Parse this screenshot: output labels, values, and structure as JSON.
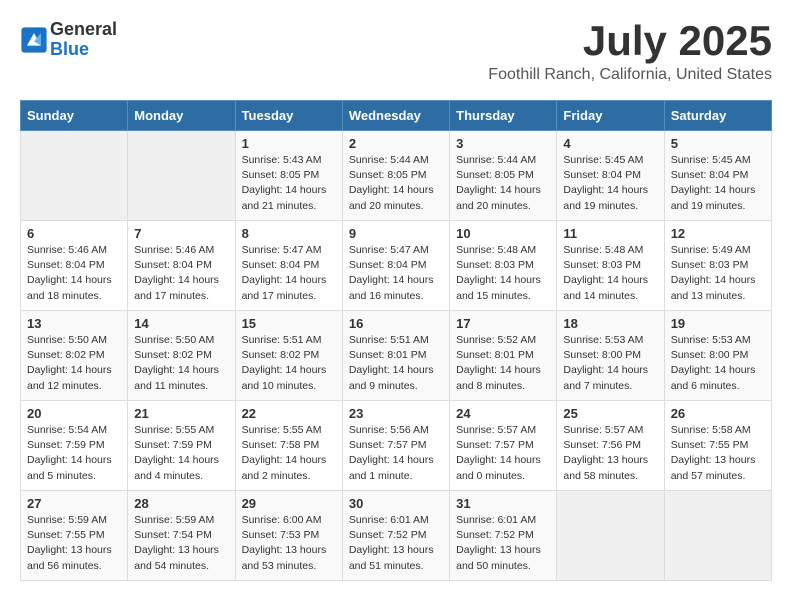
{
  "logo": {
    "general": "General",
    "blue": "Blue"
  },
  "title": "July 2025",
  "location": "Foothill Ranch, California, United States",
  "weekdays": [
    "Sunday",
    "Monday",
    "Tuesday",
    "Wednesday",
    "Thursday",
    "Friday",
    "Saturday"
  ],
  "weeks": [
    [
      {
        "day": "",
        "info": ""
      },
      {
        "day": "",
        "info": ""
      },
      {
        "day": "1",
        "info": "Sunrise: 5:43 AM\nSunset: 8:05 PM\nDaylight: 14 hours and 21 minutes."
      },
      {
        "day": "2",
        "info": "Sunrise: 5:44 AM\nSunset: 8:05 PM\nDaylight: 14 hours and 20 minutes."
      },
      {
        "day": "3",
        "info": "Sunrise: 5:44 AM\nSunset: 8:05 PM\nDaylight: 14 hours and 20 minutes."
      },
      {
        "day": "4",
        "info": "Sunrise: 5:45 AM\nSunset: 8:04 PM\nDaylight: 14 hours and 19 minutes."
      },
      {
        "day": "5",
        "info": "Sunrise: 5:45 AM\nSunset: 8:04 PM\nDaylight: 14 hours and 19 minutes."
      }
    ],
    [
      {
        "day": "6",
        "info": "Sunrise: 5:46 AM\nSunset: 8:04 PM\nDaylight: 14 hours and 18 minutes."
      },
      {
        "day": "7",
        "info": "Sunrise: 5:46 AM\nSunset: 8:04 PM\nDaylight: 14 hours and 17 minutes."
      },
      {
        "day": "8",
        "info": "Sunrise: 5:47 AM\nSunset: 8:04 PM\nDaylight: 14 hours and 17 minutes."
      },
      {
        "day": "9",
        "info": "Sunrise: 5:47 AM\nSunset: 8:04 PM\nDaylight: 14 hours and 16 minutes."
      },
      {
        "day": "10",
        "info": "Sunrise: 5:48 AM\nSunset: 8:03 PM\nDaylight: 14 hours and 15 minutes."
      },
      {
        "day": "11",
        "info": "Sunrise: 5:48 AM\nSunset: 8:03 PM\nDaylight: 14 hours and 14 minutes."
      },
      {
        "day": "12",
        "info": "Sunrise: 5:49 AM\nSunset: 8:03 PM\nDaylight: 14 hours and 13 minutes."
      }
    ],
    [
      {
        "day": "13",
        "info": "Sunrise: 5:50 AM\nSunset: 8:02 PM\nDaylight: 14 hours and 12 minutes."
      },
      {
        "day": "14",
        "info": "Sunrise: 5:50 AM\nSunset: 8:02 PM\nDaylight: 14 hours and 11 minutes."
      },
      {
        "day": "15",
        "info": "Sunrise: 5:51 AM\nSunset: 8:02 PM\nDaylight: 14 hours and 10 minutes."
      },
      {
        "day": "16",
        "info": "Sunrise: 5:51 AM\nSunset: 8:01 PM\nDaylight: 14 hours and 9 minutes."
      },
      {
        "day": "17",
        "info": "Sunrise: 5:52 AM\nSunset: 8:01 PM\nDaylight: 14 hours and 8 minutes."
      },
      {
        "day": "18",
        "info": "Sunrise: 5:53 AM\nSunset: 8:00 PM\nDaylight: 14 hours and 7 minutes."
      },
      {
        "day": "19",
        "info": "Sunrise: 5:53 AM\nSunset: 8:00 PM\nDaylight: 14 hours and 6 minutes."
      }
    ],
    [
      {
        "day": "20",
        "info": "Sunrise: 5:54 AM\nSunset: 7:59 PM\nDaylight: 14 hours and 5 minutes."
      },
      {
        "day": "21",
        "info": "Sunrise: 5:55 AM\nSunset: 7:59 PM\nDaylight: 14 hours and 4 minutes."
      },
      {
        "day": "22",
        "info": "Sunrise: 5:55 AM\nSunset: 7:58 PM\nDaylight: 14 hours and 2 minutes."
      },
      {
        "day": "23",
        "info": "Sunrise: 5:56 AM\nSunset: 7:57 PM\nDaylight: 14 hours and 1 minute."
      },
      {
        "day": "24",
        "info": "Sunrise: 5:57 AM\nSunset: 7:57 PM\nDaylight: 14 hours and 0 minutes."
      },
      {
        "day": "25",
        "info": "Sunrise: 5:57 AM\nSunset: 7:56 PM\nDaylight: 13 hours and 58 minutes."
      },
      {
        "day": "26",
        "info": "Sunrise: 5:58 AM\nSunset: 7:55 PM\nDaylight: 13 hours and 57 minutes."
      }
    ],
    [
      {
        "day": "27",
        "info": "Sunrise: 5:59 AM\nSunset: 7:55 PM\nDaylight: 13 hours and 56 minutes."
      },
      {
        "day": "28",
        "info": "Sunrise: 5:59 AM\nSunset: 7:54 PM\nDaylight: 13 hours and 54 minutes."
      },
      {
        "day": "29",
        "info": "Sunrise: 6:00 AM\nSunset: 7:53 PM\nDaylight: 13 hours and 53 minutes."
      },
      {
        "day": "30",
        "info": "Sunrise: 6:01 AM\nSunset: 7:52 PM\nDaylight: 13 hours and 51 minutes."
      },
      {
        "day": "31",
        "info": "Sunrise: 6:01 AM\nSunset: 7:52 PM\nDaylight: 13 hours and 50 minutes."
      },
      {
        "day": "",
        "info": ""
      },
      {
        "day": "",
        "info": ""
      }
    ]
  ]
}
